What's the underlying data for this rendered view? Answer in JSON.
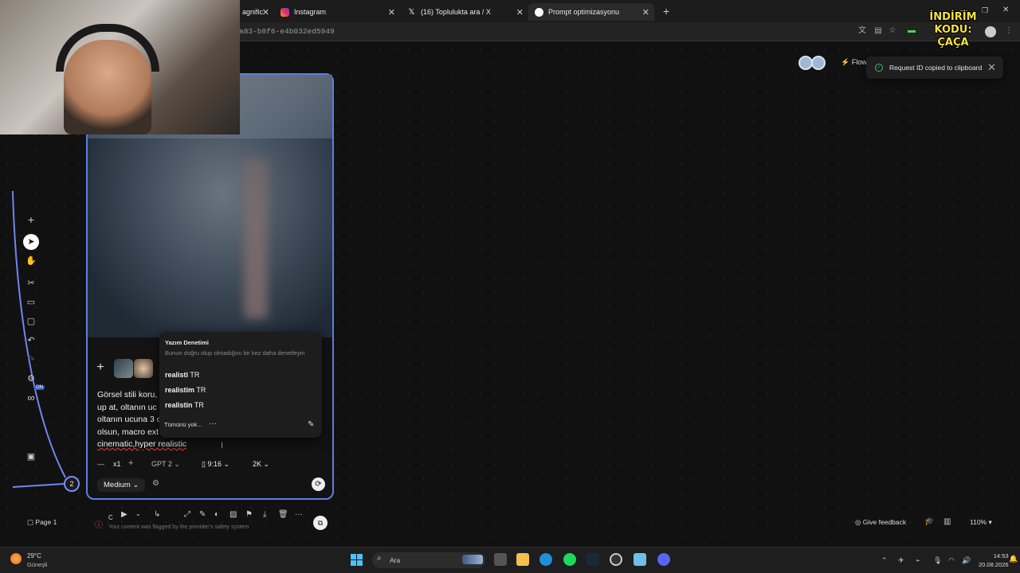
{
  "browser": {
    "tabs": [
      {
        "title": "agnific",
        "close": "✕"
      },
      {
        "title": "Instagram",
        "close": "✕"
      },
      {
        "title": "(16) Toplulukta ara / X",
        "close": "✕"
      },
      {
        "title": "Prompt optimizasyonu",
        "close": "✕"
      }
    ],
    "new_tab": "+",
    "url": "a83-b8f6-e4b032ed5949",
    "window_controls": [
      "—",
      "❐",
      "✕"
    ]
  },
  "overlay_promo": {
    "line1": "İNDİRİM KODU:",
    "line2": "ÇAÇA"
  },
  "header": {
    "flow_label": "Flow",
    "toast": {
      "text": "Request ID copied to clipboard",
      "close": "✕",
      "icon": "check-circle-icon"
    }
  },
  "left_toolbar": {
    "on_badge": "ON"
  },
  "node": {
    "number": "2",
    "prompt_lines": [
      "Görsel stili koru,",
      "up at, oltanın uc",
      "oltanın ucuna 3 c",
      "olsun, macro ext",
      "cinematic,hyper realistic"
    ],
    "count": "x1",
    "model": "GPT 2",
    "aspect": "9:16",
    "resolution": "2K",
    "quality": "Medium"
  },
  "spellcheck": {
    "title": "Yazım Denetimi",
    "subtitle": "Bunun doğru olup olmadığını bir kez daha denetleyin",
    "suggestions": [
      {
        "word": "realisti",
        "lang": "TR"
      },
      {
        "word": "realistim",
        "lang": "TR"
      },
      {
        "word": "realistin",
        "lang": "TR"
      }
    ],
    "ignore_all": "Tümünü yok...",
    "more": "···"
  },
  "node_toolbar": {
    "flagged_text": "Your content was flagged by the provider's safety system",
    "partial_label": "C"
  },
  "bottom_bar": {
    "page": "Page 1",
    "feedback": "Give feedback",
    "zoom": "110%"
  },
  "taskbar": {
    "temperature": "29°C",
    "weather": "Güneşli",
    "search_placeholder": "Ara",
    "time": "14:53",
    "date": "20.08.2026"
  }
}
